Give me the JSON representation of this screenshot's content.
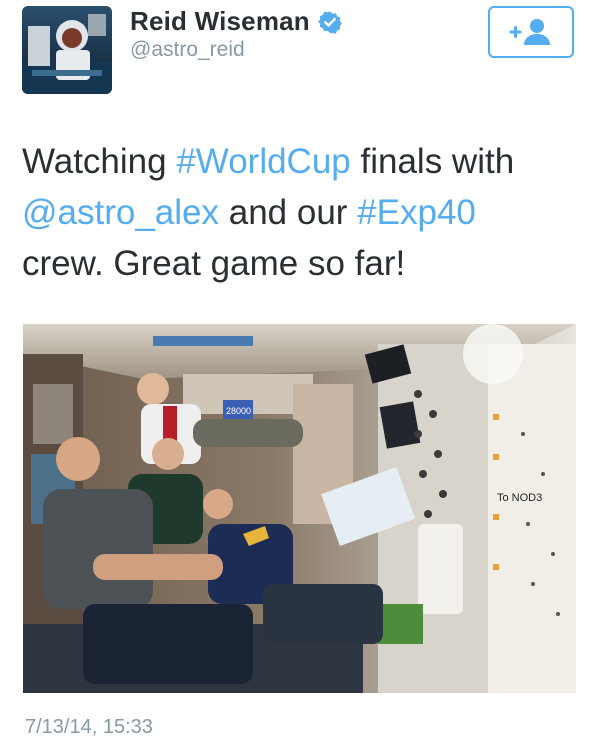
{
  "author": {
    "display_name": "Reid Wiseman",
    "handle": "@astro_reid",
    "verified_icon": "verified-badge-icon",
    "avatar_icon": "astronaut-avatar"
  },
  "follow_button": {
    "icon": "follow-user-plus-icon"
  },
  "tweet": {
    "segments": [
      {
        "text": "Watching ",
        "link": false
      },
      {
        "text": "#WorldCup",
        "link": true
      },
      {
        "text": " finals with ",
        "link": false
      },
      {
        "text": "@astro_alex",
        "link": true
      },
      {
        "text": " and our ",
        "link": false
      },
      {
        "text": "#Exp40",
        "link": true
      },
      {
        "text": " crew. Great game so far!",
        "link": false
      }
    ]
  },
  "photo": {
    "sign_label": "To NOD3",
    "number_label": "28000"
  },
  "timestamp": "7/13/14, 15:33",
  "colors": {
    "link": "#55acee",
    "text": "#292f33",
    "muted": "#8899a6"
  }
}
